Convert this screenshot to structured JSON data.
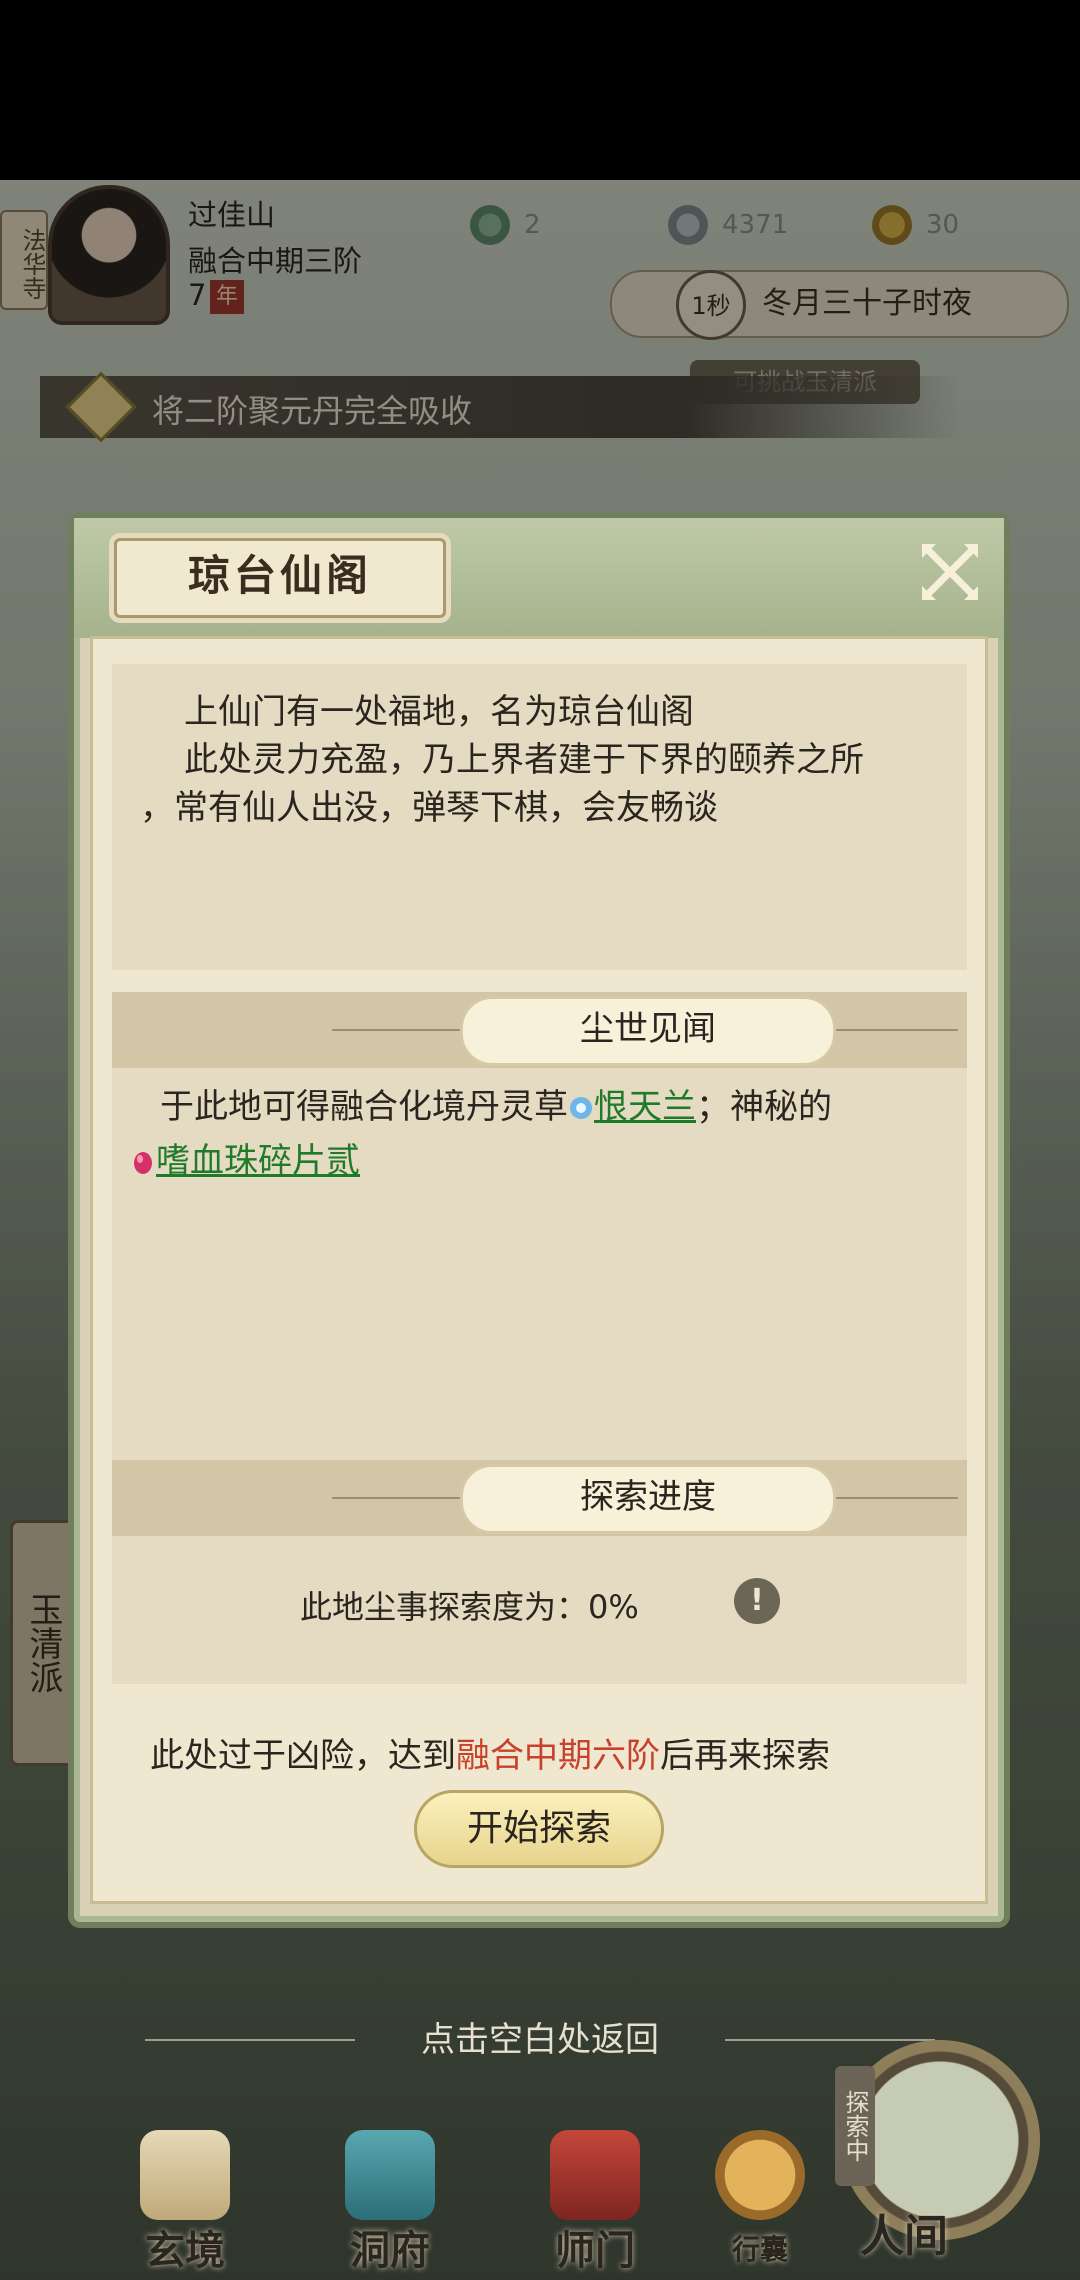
{
  "header": {
    "side_tab": "法华寺",
    "player_name": "过佳山",
    "realm": "融合中期三阶",
    "age_value": "7",
    "age_unit": "年",
    "resources": [
      {
        "icon": "jade-token-icon",
        "value": "2"
      },
      {
        "icon": "spirit-stone-icon",
        "value": "4371"
      },
      {
        "icon": "gold-ingot-icon",
        "value": "30"
      }
    ],
    "time_speed": "1秒",
    "game_time": "冬月三十子时夜",
    "challenge": "可挑战玉清派"
  },
  "quest": {
    "text": "将二阶聚元丹完全吸收"
  },
  "left_tab": "玉清派",
  "dialog": {
    "title": "琼台仙阁",
    "description": [
      "上仙门有一处福地，名为琼台仙阁",
      "此处灵力充盈，乃上界者建于下界的颐养之所",
      "，常有仙人出没，弹琴下棋，会友畅谈"
    ],
    "lore_header": "尘世见闻",
    "lore_text_1": "于此地可得融合化境丹灵草",
    "lore_link_1": "恨天兰",
    "lore_text_2": "；神秘的",
    "lore_link_2": "嗜血珠碎片贰",
    "progress_header": "探索进度",
    "progress_label": "此地尘事探索度为：",
    "progress_value": "0%",
    "warning_prefix": "此处过于凶险，达到",
    "warning_realm": "融合中期六阶",
    "warning_suffix": "后再来探索",
    "start_button": "开始探索"
  },
  "back_hint": "点击空白处返回",
  "nav": [
    {
      "label": "玄境",
      "icon": "scroll-icon"
    },
    {
      "label": "洞府",
      "icon": "pavilion-icon"
    },
    {
      "label": "师门",
      "icon": "banner-icon"
    },
    {
      "label": "行囊",
      "icon": "bag-icon"
    }
  ],
  "explore": {
    "tag": "探索中",
    "label": "人间"
  },
  "colors": {
    "link": "#1f7a2a",
    "realm_red": "#c7412c",
    "panel": "#e5dbc2"
  }
}
